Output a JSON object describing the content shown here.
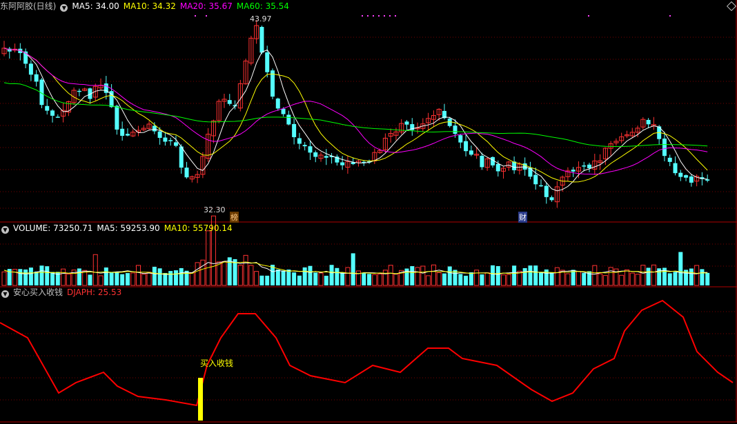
{
  "main_header": {
    "stock_title": "东阿阿胶(日线)",
    "ma5": "MA5: 34.00",
    "ma10": "MA10: 34.32",
    "ma20": "MA20: 35.67",
    "ma60": "MA60: 35.54"
  },
  "volume_header": {
    "volume": "VOLUME: 73250.71",
    "ma5": "MA5: 59253.90",
    "ma10": "MA10: 55790.14"
  },
  "indicator_header": {
    "name": "安心买入收钱",
    "value": "DJAPH: 25.53"
  },
  "annotations": {
    "high_label": "43.97",
    "low_label": "32.30",
    "marker_bang": "榜",
    "marker_cai": "财",
    "buy_signal": "买入收钱"
  },
  "colors": {
    "up": "#ff3232",
    "down": "#54ffff",
    "ma5": "#ffffff",
    "ma10": "#ffff00",
    "ma20": "#ff00ff",
    "ma60": "#00ff00",
    "indicator": "#ff0000",
    "signal": "#ffff00",
    "grid": "#7a0000",
    "divider": "#b00000"
  }
}
